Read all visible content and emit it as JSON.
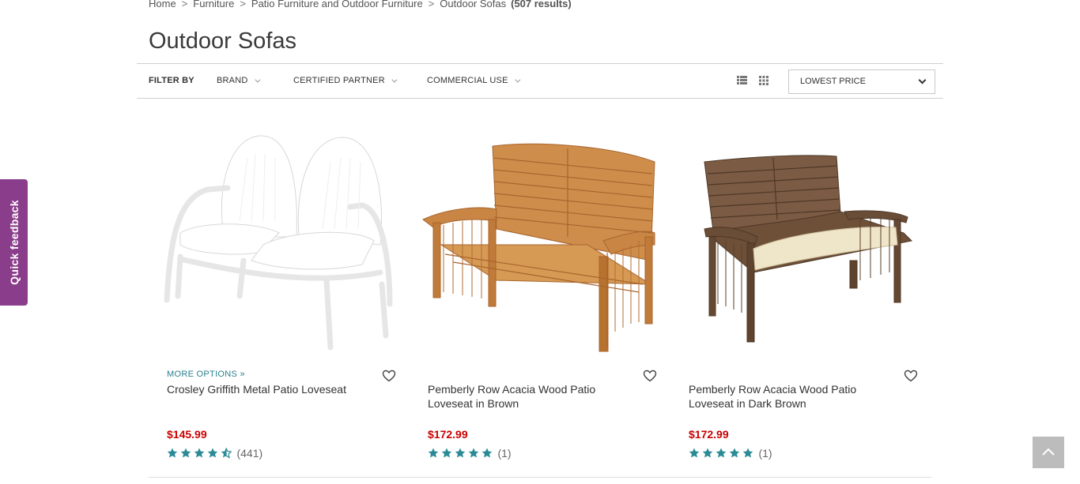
{
  "breadcrumb": {
    "items": [
      "Home",
      "Furniture",
      "Patio Furniture and Outdoor Furniture",
      "Outdoor Sofas"
    ],
    "separator": ">",
    "results": "(507 results)"
  },
  "page_title": "Outdoor Sofas",
  "filter_bar": {
    "label": "FILTER BY",
    "filters": [
      "BRAND",
      "CERTIFIED PARTNER",
      "COMMERCIAL USE"
    ],
    "view_icons": [
      "list-view-icon",
      "grid-view-icon"
    ],
    "sort_selected": "LOWEST PRICE"
  },
  "products": [
    {
      "more_options": "MORE OPTIONS »",
      "name": "Crosley Griffith Metal Patio Loveseat",
      "price": "$145.99",
      "rating": 4.5,
      "reviews": "(441)",
      "image": "white-metal-loveseat"
    },
    {
      "more_options": "",
      "name": "Pemberly Row Acacia Wood Patio Loveseat in Brown",
      "price": "$172.99",
      "rating": 5,
      "reviews": "(1)",
      "image": "acacia-wood-loveseat-brown"
    },
    {
      "more_options": "",
      "name": "Pemberly Row Acacia Wood Patio Loveseat in Dark Brown",
      "price": "$172.99",
      "rating": 5,
      "reviews": "(1)",
      "image": "acacia-wood-loveseat-dark-brown"
    }
  ],
  "quick_feedback": "Quick feedback",
  "colors": {
    "accent_teal": "#2a7f8f",
    "star": "#2a8a96",
    "price_red": "#cc0000",
    "feedback_purple": "#8a3d8a"
  }
}
